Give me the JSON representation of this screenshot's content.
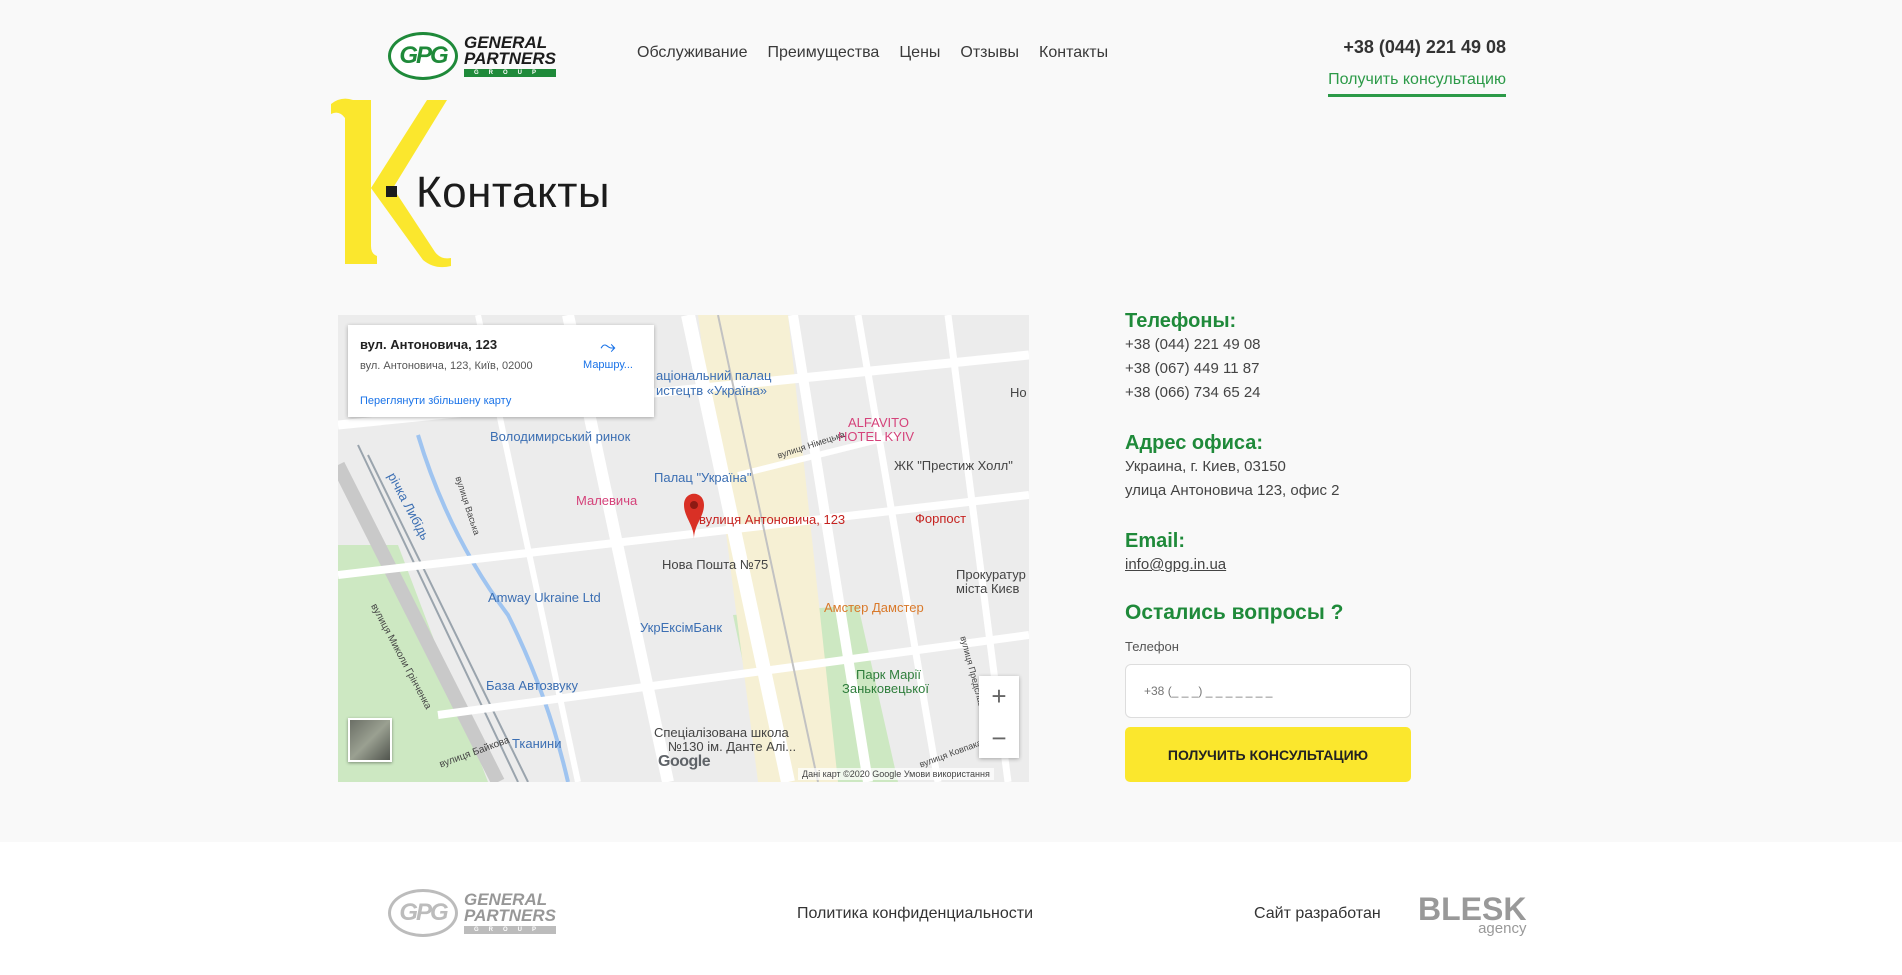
{
  "header": {
    "logo_mark": "GPG",
    "logo_line1": "GENERAL",
    "logo_line2": "PARTNERS",
    "logo_line3": "GROUP",
    "nav": [
      "Обслуживание",
      "Преимущества",
      "Цены",
      "Отзывы",
      "Контакты"
    ],
    "phone": "+38 (044) 221 49 08",
    "cta": "Получить консультацию"
  },
  "page": {
    "title": "Контакты"
  },
  "map": {
    "card_title": "вул. Антоновича, 123",
    "card_address": "вул. Антоновича, 123, Київ, 02000",
    "card_route": "Маршру...",
    "card_view_larger": "Переглянути збільшену карту",
    "pois": {
      "palace_culture_1": "аціональний палац",
      "palace_culture_2": "истецтв «Україна»",
      "volodymyr_market": "Володимирський ринок",
      "alfavito_1": "ALFAVITO",
      "alfavito_2": "HOTEL KYIV",
      "palace_ukraine": "Палац \"Україна\"",
      "prestige": "ЖК \"Престиж Холл\"",
      "river": "річка Либідь",
      "malevich": "Малевича",
      "marker_label": "вулиця Антоновича, 123",
      "forpost": "Форпост",
      "nova_poshta": "Нова Пошта №75",
      "amway": "Amway Ukraine Ltd",
      "amster": "Амстер Дамстер",
      "prokuratura_1": "Прокуратур",
      "prokuratura_2": "міста Києв",
      "ukreximbank": "УкрЕксімБанк",
      "park_1": "Парк Марії",
      "park_2": "Заньковецької",
      "baza": "База Автозвуку",
      "school_1": "Спеціалізована школа",
      "school_2": "№130 ім. Данте Алі...",
      "tkanyny": "Тканини",
      "street_hrinchenka": "вулиця Миколи Грінченка",
      "street_baikova": "вулиця Байкова",
      "street_vaska": "вулиця Васька",
      "street_nimetska": "вулиця Німецька",
      "street_kovpaka": "вулиця Ковпака",
      "street_predslav": "вулиця Предславинська",
      "edge_ho": "Но"
    },
    "zoom_in": "+",
    "zoom_out": "−",
    "google": "Google",
    "attribution": "Дані карт ©2020 Google   Умови використання"
  },
  "contacts": {
    "phones_title": "Телефоны:",
    "phones": [
      "+38 (044) 221 49 08",
      "+38 (067) 449 11 87",
      "+38 (066) 734 65 24"
    ],
    "address_title": "Адрес офиса:",
    "address_line1": "Украина, г. Киев, 03150",
    "address_line2": "улица Антоновича 123, офис 2",
    "email_title": "Email:",
    "email": "info@gpg.in.ua"
  },
  "form": {
    "title": "Остались вопросы ?",
    "phone_label": "Телефон",
    "phone_placeholder": "+38 (_ _ _) _ _ _ _ _ _ _",
    "submit": "ПОЛУЧИТЬ КОНСУЛЬТАЦИЮ"
  },
  "footer": {
    "policy": "Политика конфиденциальности",
    "developer": "Сайт разработан",
    "dev_logo_1": "BLESK",
    "dev_logo_2": "agency"
  },
  "colors": {
    "green": "#1f8a3a",
    "yellow": "#fbe72d",
    "accent_link": "#2c9a48"
  }
}
